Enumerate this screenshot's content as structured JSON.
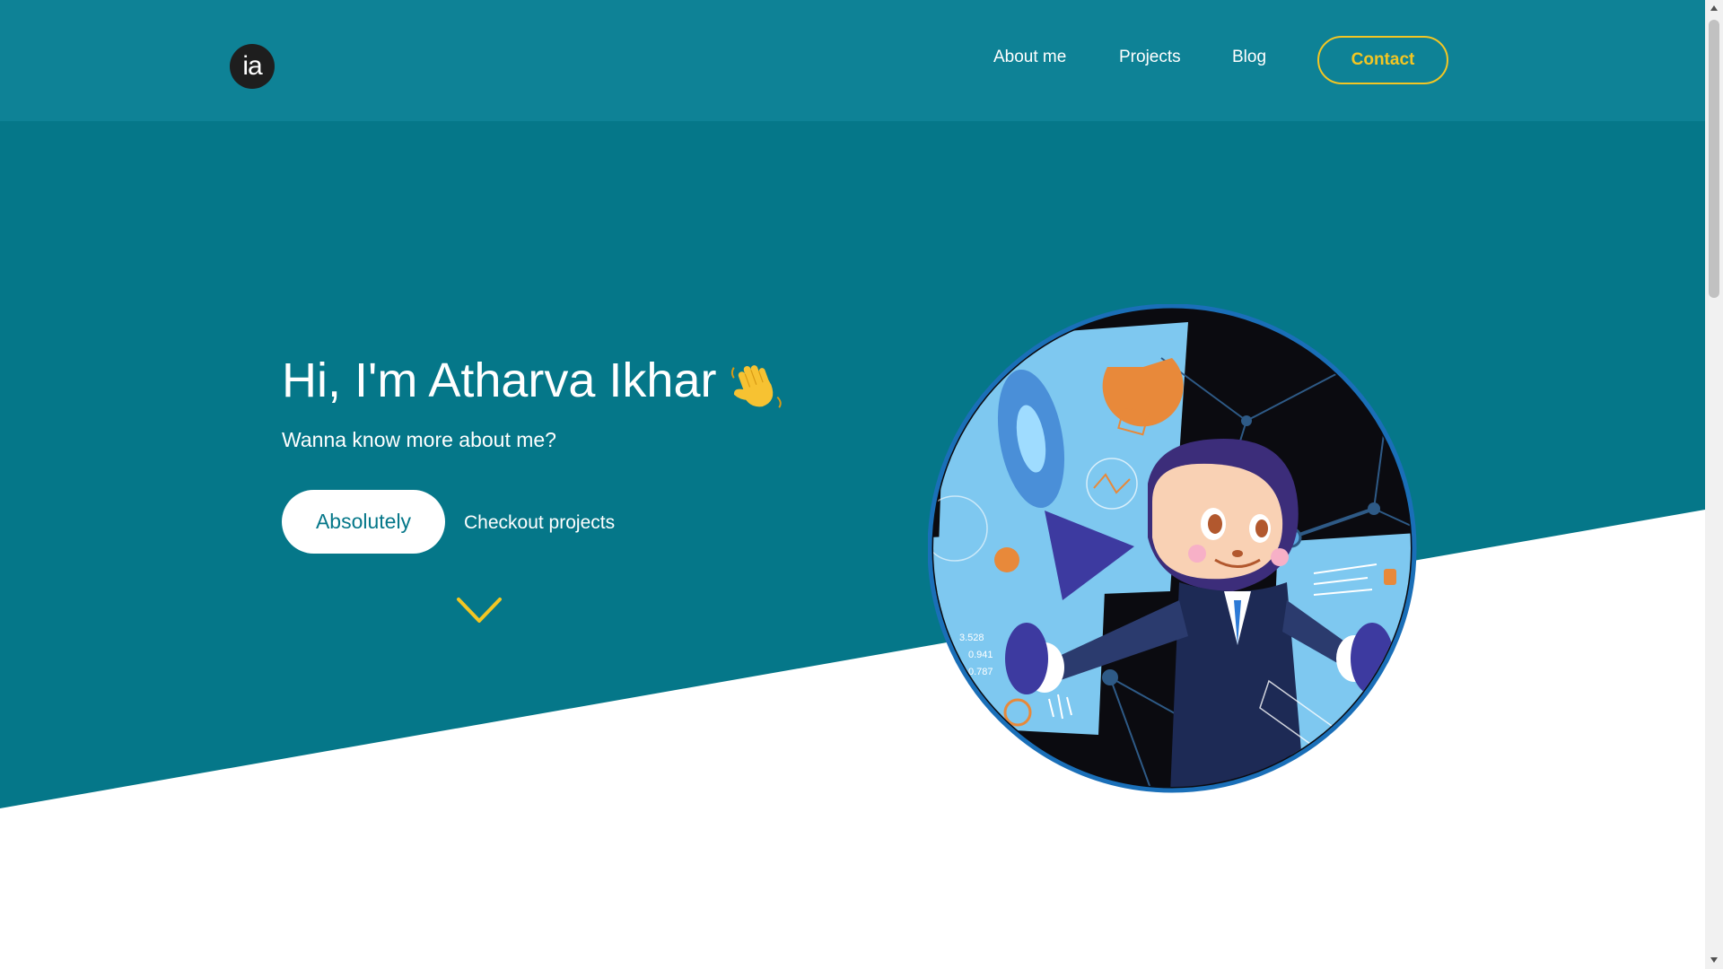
{
  "navbar": {
    "logo_text": "ia",
    "links": [
      {
        "label": "About me"
      },
      {
        "label": "Projects"
      },
      {
        "label": "Blog"
      }
    ],
    "contact_label": "Contact"
  },
  "hero": {
    "headline": "Hi, I'm Atharva Ikhar",
    "wave_icon": "waving-hand-icon",
    "subtitle": "Wanna know more about me?",
    "primary_cta": "Absolutely",
    "secondary_cta": "Checkout projects",
    "scroll_icon": "chevron-down-icon",
    "illustration": "octocat-business-illustration",
    "illustration_labels": [
      "3.528",
      "0.941",
      "0.787"
    ]
  },
  "colors": {
    "navbar_bg": "#0e8296",
    "hero_bg": "#057789",
    "accent": "#f3c623",
    "page_bg": "#ffffff"
  }
}
